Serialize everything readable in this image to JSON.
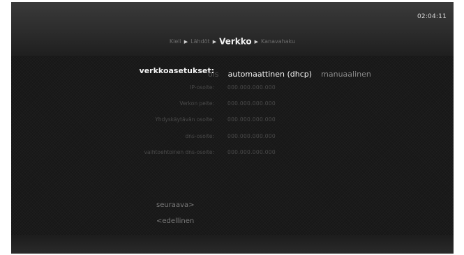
{
  "header": {
    "clock": "02:04:11",
    "breadcrumb": [
      {
        "label": "Kieli",
        "active": false
      },
      {
        "label": "Lähdöt",
        "active": false
      },
      {
        "label": "Verkko",
        "active": true
      },
      {
        "label": "Kanavahaku",
        "active": false
      }
    ]
  },
  "network": {
    "mode_label": "verkkoasetukset:",
    "options": {
      "off": "ois",
      "auto": "automaattinen (dhcp)",
      "manual": "manuaalinen"
    },
    "fields": [
      {
        "label": "IP-osoite:",
        "value": "000.000.000.000"
      },
      {
        "label": "Verkon peite:",
        "value": "000.000.000.000"
      },
      {
        "label": "Yhdyskäytävän osoite:",
        "value": "000.000.000.000"
      },
      {
        "label": "dns-osoite:",
        "value": "000.000.000.000"
      },
      {
        "label": "vaihtoehtoinen dns-osoite:",
        "value": "000.000.000.000"
      }
    ]
  },
  "navigation": {
    "next": "seuraava>",
    "previous": "<edellinen"
  }
}
